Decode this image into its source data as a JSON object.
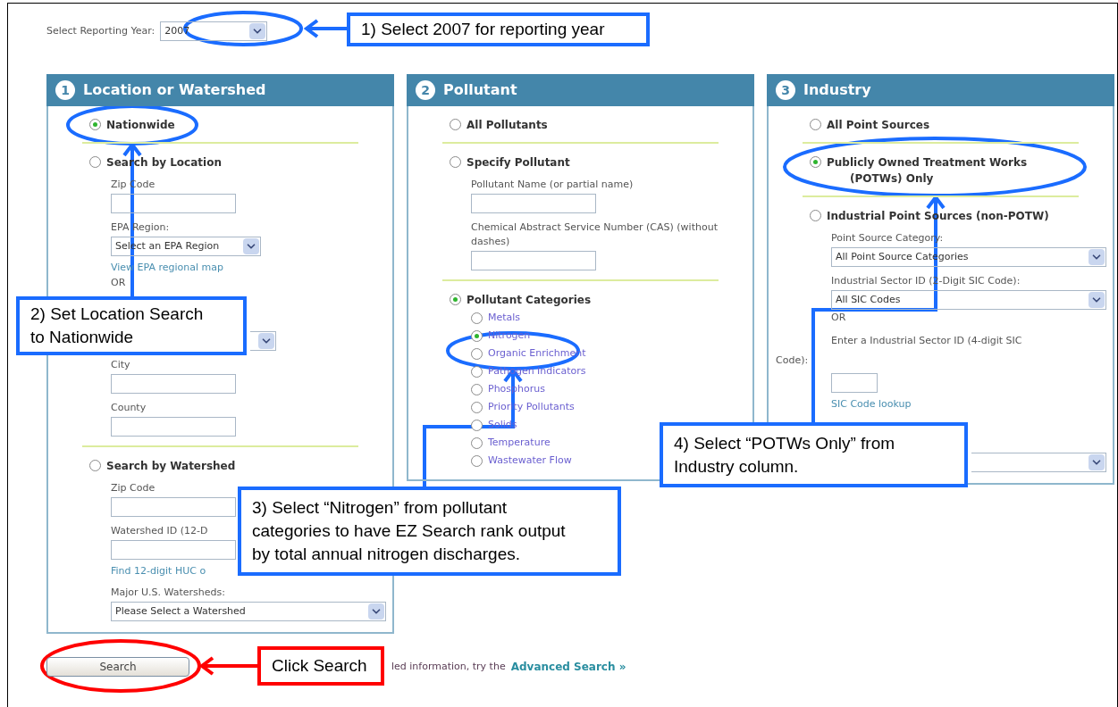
{
  "year": {
    "label": "Select Reporting Year:",
    "value": "2007"
  },
  "panels": [
    {
      "number": "1",
      "title": "Location or Watershed",
      "items": [
        {
          "kind": "radio",
          "label": "Nationwide",
          "selected": true
        },
        {
          "kind": "divider"
        },
        {
          "kind": "radio",
          "label": "Search by Location",
          "selected": false
        },
        {
          "kind": "label",
          "text": "Zip Code"
        },
        {
          "kind": "input"
        },
        {
          "kind": "label",
          "text": "EPA Region:"
        },
        {
          "kind": "select",
          "value": "Select an EPA Region"
        },
        {
          "kind": "link",
          "text": "View EPA regional map"
        },
        {
          "kind": "or",
          "text": "OR"
        },
        {
          "kind": "covered"
        },
        {
          "kind": "select_tail"
        },
        {
          "kind": "label",
          "text": "City"
        },
        {
          "kind": "input"
        },
        {
          "kind": "label",
          "text": "County"
        },
        {
          "kind": "input"
        },
        {
          "kind": "divider"
        },
        {
          "kind": "radio",
          "label": "Search by Watershed",
          "selected": false
        },
        {
          "kind": "label",
          "text": "Zip Code"
        },
        {
          "kind": "input"
        },
        {
          "kind": "label",
          "text": "Watershed ID (12-D"
        },
        {
          "kind": "input"
        },
        {
          "kind": "link",
          "text": "Find 12-digit HUC o"
        },
        {
          "kind": "label",
          "text": "Major U.S. Watersheds:"
        },
        {
          "kind": "select_wide",
          "value": "Please Select a Watershed"
        }
      ]
    },
    {
      "number": "2",
      "title": "Pollutant",
      "items": [
        {
          "kind": "radio",
          "label": "All Pollutants",
          "selected": false
        },
        {
          "kind": "divider"
        },
        {
          "kind": "radio",
          "label": "Specify Pollutant",
          "selected": false
        },
        {
          "kind": "label",
          "text": "Pollutant Name (or partial name)"
        },
        {
          "kind": "input"
        },
        {
          "kind": "label",
          "text": "Chemical Abstract Service Number (CAS) (without dashes)"
        },
        {
          "kind": "input"
        },
        {
          "kind": "divider"
        },
        {
          "kind": "radio",
          "label": "Pollutant Categories",
          "selected": true
        },
        {
          "kind": "option",
          "label": "Metals",
          "selected": false
        },
        {
          "kind": "option",
          "label": "Nitrogen",
          "selected": true
        },
        {
          "kind": "option",
          "label": "Organic Enrichment",
          "selected": false
        },
        {
          "kind": "option",
          "label": "Pathogen Indicators",
          "selected": false
        },
        {
          "kind": "option",
          "label": "Phosphorus",
          "selected": false
        },
        {
          "kind": "option",
          "label": "Priority Pollutants",
          "selected": false
        },
        {
          "kind": "option",
          "label": "Solids",
          "selected": false
        },
        {
          "kind": "option",
          "label": "Temperature",
          "selected": false
        },
        {
          "kind": "option",
          "label": "Wastewater Flow",
          "selected": false
        }
      ]
    },
    {
      "number": "3",
      "title": "Industry",
      "items": [
        {
          "kind": "radio",
          "label": "All Point Sources",
          "selected": false
        },
        {
          "kind": "divider"
        },
        {
          "kind": "radio",
          "label": "Publicly Owned Treatment Works",
          "continuation": "(POTWs) Only",
          "selected": true
        },
        {
          "kind": "divider"
        },
        {
          "kind": "radio",
          "label": "Industrial Point Sources (non-POTW)",
          "selected": false
        },
        {
          "kind": "label",
          "text": "Point Source Category:"
        },
        {
          "kind": "select_wide",
          "value": "All Point Source Categories"
        },
        {
          "kind": "label",
          "text": "Industrial Sector ID (2-Digit SIC Code):"
        },
        {
          "kind": "select_wide",
          "value": "All SIC Codes"
        },
        {
          "kind": "or",
          "text": "OR"
        },
        {
          "kind": "wrapped",
          "text": "Enter a Industrial Sector ID (4-digit SIC",
          "tail": "Code):"
        },
        {
          "kind": "input_short"
        },
        {
          "kind": "link",
          "text": "SIC Code lookup"
        },
        {
          "kind": "covered"
        },
        {
          "kind": "select_tail_wide"
        }
      ]
    }
  ],
  "search": {
    "button": "Search",
    "hint": "led information, try the",
    "link": "Advanced Search »"
  },
  "callouts": [
    {
      "lines": [
        "1) Select 2007  for reporting year"
      ],
      "color": "#1a6cff"
    },
    {
      "lines": [
        "2) Set Location Search",
        "to Nationwide"
      ],
      "color": "#1a6cff"
    },
    {
      "lines": [
        "3) Select “Nitrogen” from pollutant",
        "categories to have EZ Search rank output",
        "by total annual nitrogen discharges."
      ],
      "color": "#1a6cff"
    },
    {
      "lines": [
        "4) Select “POTWs Only” from",
        "Industry column."
      ],
      "color": "#1a6cff"
    },
    {
      "lines": [
        "Click Search"
      ],
      "color": "#ff0000"
    }
  ]
}
